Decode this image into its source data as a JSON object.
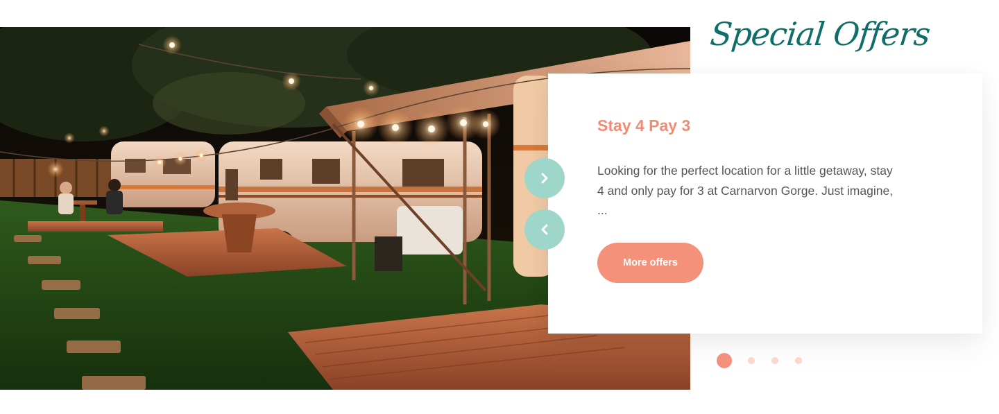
{
  "section": {
    "heading": "Special Offers"
  },
  "hero": {
    "alt": "Vintage caravans at night with string lights and timber decks"
  },
  "carousel": {
    "next_icon": "chevron-right-icon",
    "prev_icon": "chevron-left-icon",
    "slide_count": 4,
    "active_index": 0
  },
  "offer": {
    "title": "Stay 4 Pay 3",
    "description": "Looking for the perfect location for a little getaway, stay 4 and only pay for 3 at Carnarvon Gorge. Just imagine, ...",
    "button_label": "More offers"
  },
  "colors": {
    "heading": "#0f6e68",
    "accent": "#f4917b",
    "title": "#f08c74",
    "arrow": "#9fd6ca",
    "dot_inactive": "#fbd6cc"
  }
}
